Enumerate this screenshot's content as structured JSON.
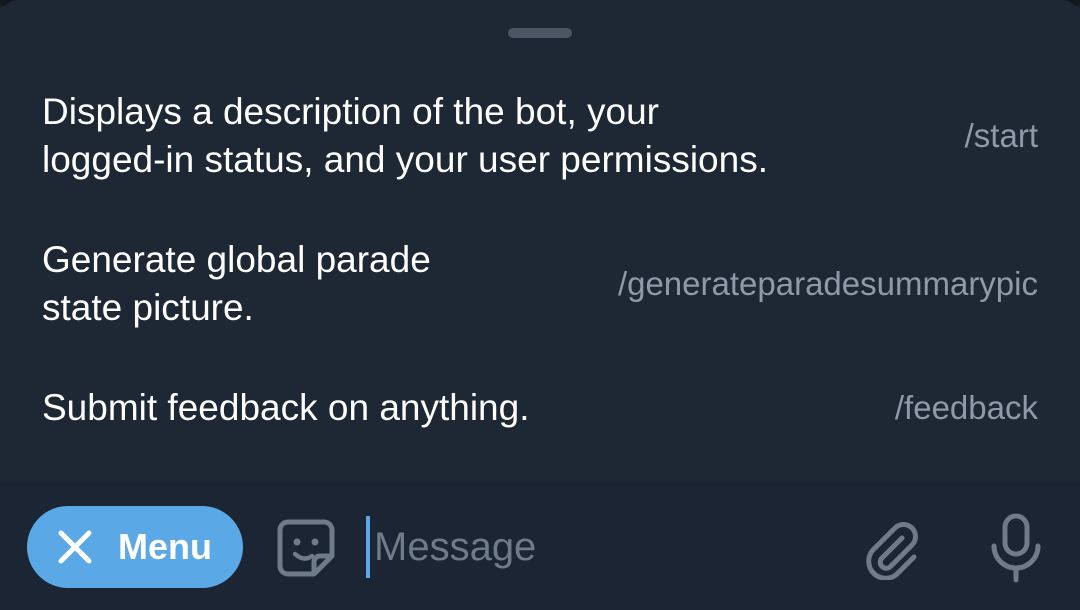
{
  "commands": [
    {
      "description": "Displays a description of the bot, your\nlogged-in status, and your user permissions.",
      "command": "/start"
    },
    {
      "description": "Generate global parade\nstate picture.",
      "command": "/generateparadesummarypic"
    },
    {
      "description": "Submit feedback on anything.",
      "command": "/feedback"
    }
  ],
  "input_bar": {
    "menu_label": "Menu",
    "message_placeholder": "Message",
    "icons": {
      "menu_close": "close-icon",
      "sticker": "sticker-icon",
      "attach": "paperclip-icon",
      "voice": "microphone-icon"
    }
  },
  "colors": {
    "accent": "#5aa9e6",
    "sheet_bg": "#1e2834",
    "secondary_text": "#8f9aa8"
  }
}
